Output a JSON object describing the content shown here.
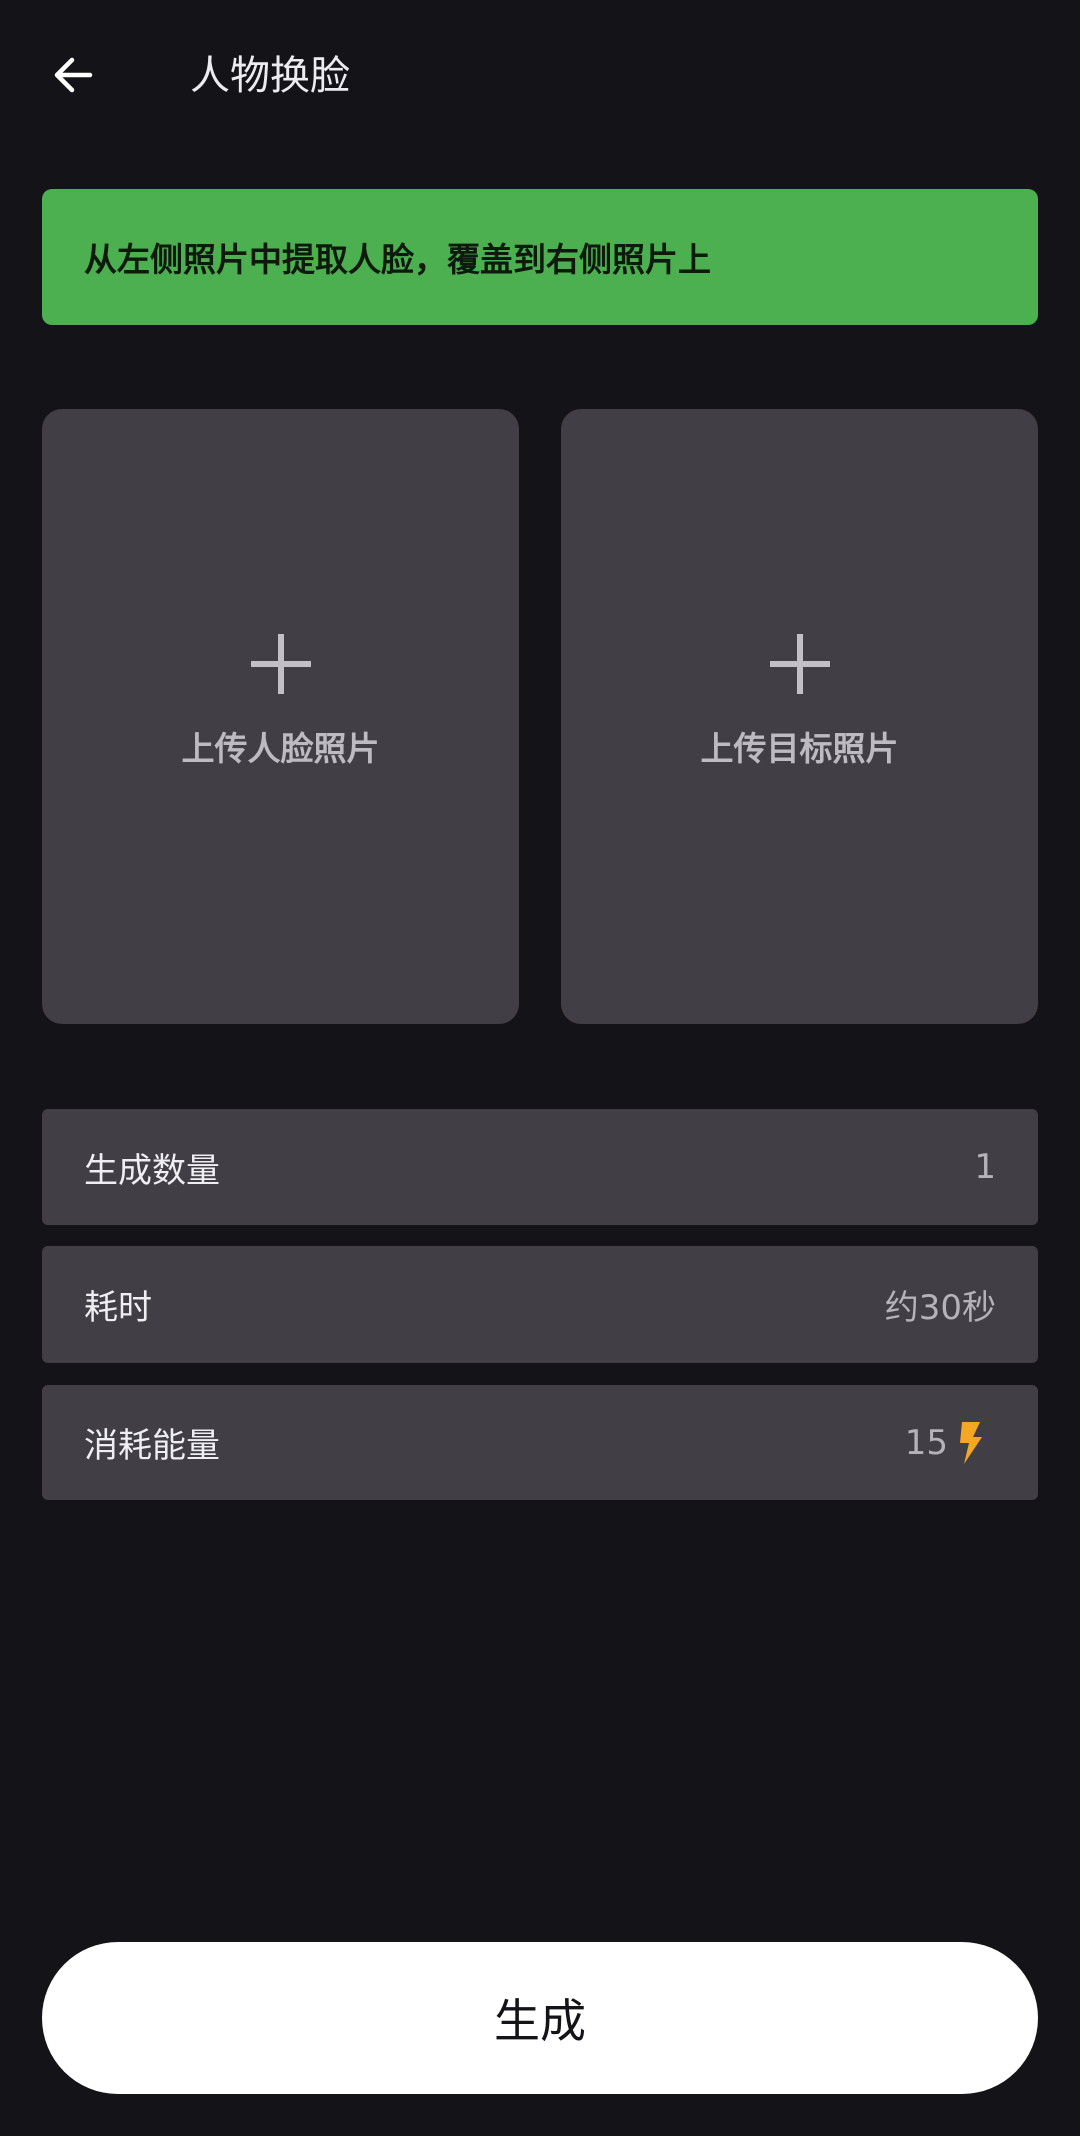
{
  "header": {
    "title": "人物换脸",
    "back_icon": "arrow-left-icon"
  },
  "banner": {
    "text": "从左侧照片中提取人脸，覆盖到右侧照片上",
    "color": "#4caf50"
  },
  "uploads": {
    "face_label": "上传人脸照片",
    "target_label": "上传目标照片",
    "icon": "plus-icon"
  },
  "settings": [
    {
      "label": "生成数量",
      "value": "1"
    },
    {
      "label": "耗时",
      "value": "约30秒"
    },
    {
      "label": "消耗能量",
      "value": "15",
      "icon": "lightning-bolt-icon",
      "icon_color": "#f5a623"
    }
  ],
  "generate": {
    "label": "生成"
  },
  "colors": {
    "background": "#141318",
    "card": "#413f45",
    "accent": "#4caf50",
    "button": "#ffffff"
  }
}
